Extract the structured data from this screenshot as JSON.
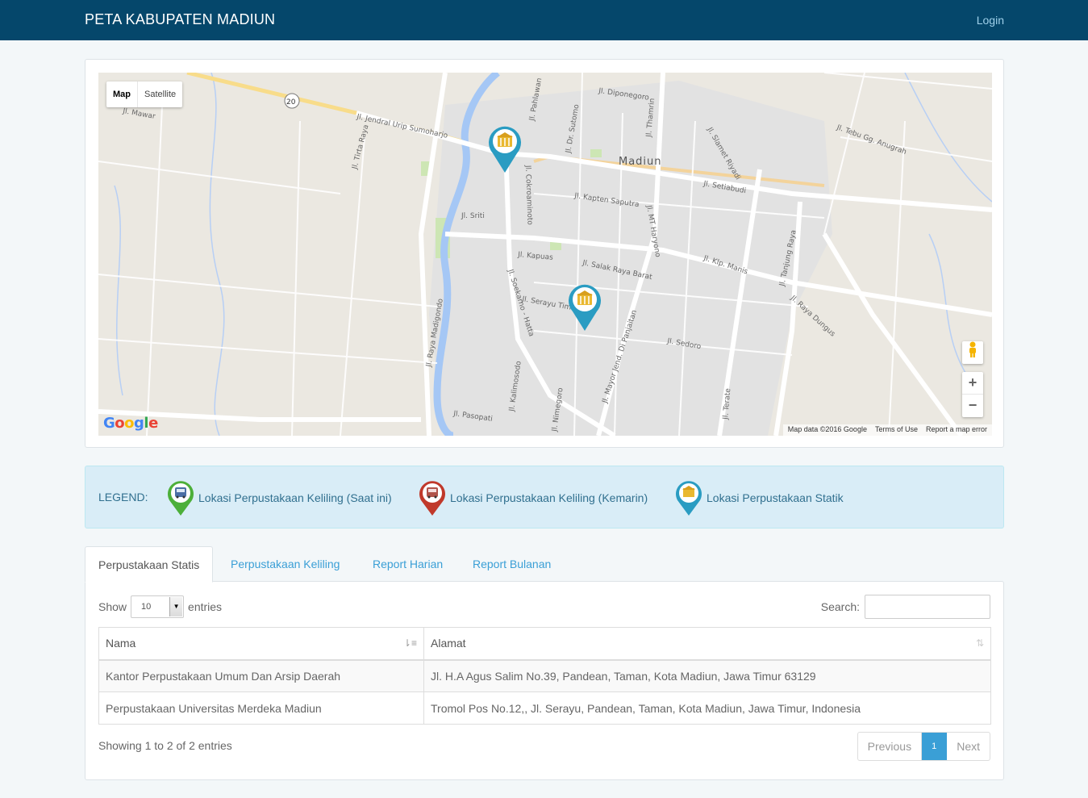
{
  "navbar": {
    "brand": "PETA KABUPATEN MADIUN",
    "login": "Login"
  },
  "map": {
    "type_buttons": [
      "Map",
      "Satellite"
    ],
    "city_label": "Madiun",
    "route_label": "20",
    "street_labels": [
      "Jl. Jendral Urip Sumoharjo",
      "Jl. Mawar",
      "Jl. Tirta Raya",
      "Jl. Diponegoro",
      "Jl. Pahlawan",
      "Jl. Dr. Sutomo",
      "Jl. Thamrin",
      "Jl. Slamet Riyadi",
      "Jl. Setiabudi",
      "Jl. Kapten Saputra",
      "Jl. Cokroaminoto",
      "Jl. Sriti",
      "Jl. Kapuas",
      "Jl. Salak Raya Barat",
      "Jl. MT Haryono",
      "Jl. Klp. Manis",
      "Jl. Tanjung Raya",
      "Jl. Raya Dungus",
      "Jl. Serayu Timur",
      "Jl. Soekarno - Hatta",
      "Jl. Raya Madigondo",
      "Jl. Sedoro",
      "Jl. Mayor Jend. Di Panjaitan",
      "Jl. Pasopati",
      "Jl. Nimegoro",
      "Jl. Tebu Gg. Anugrah",
      "Jl. Kalimosodo",
      "Jl. Terate"
    ],
    "attribution": [
      "Map data ©2016 Google",
      "Terms of Use",
      "Report a map error"
    ],
    "google_logo": [
      "G",
      "o",
      "o",
      "g",
      "l",
      "e"
    ],
    "zoom_in": "+",
    "zoom_out": "−",
    "markers": [
      {
        "type": "statik",
        "color": "#2a9cc2"
      },
      {
        "type": "statik",
        "color": "#2a9cc2"
      }
    ]
  },
  "legend": {
    "title": "LEGEND:",
    "items": [
      {
        "label": "Lokasi Perpustakaan Keliling (Saat ini)",
        "color": "#4caf3a",
        "icon": "bus-icon"
      },
      {
        "label": "Lokasi Perpustakaan Keliling (Kemarin)",
        "color": "#c0392b",
        "icon": "bus-icon"
      },
      {
        "label": "Lokasi Perpustakaan Statik",
        "color": "#2a9cc2",
        "icon": "library-icon"
      }
    ]
  },
  "tabs": [
    "Perpustakaan Statis",
    "Perpustakaan Keliling",
    "Report Harian",
    "Report Bulanan"
  ],
  "table": {
    "show_label": "Show",
    "entries_value": "10",
    "entries_label": "entries",
    "search_label": "Search:",
    "columns": [
      "Nama",
      "Alamat"
    ],
    "rows": [
      [
        "Kantor Perpustakaan Umum Dan Arsip Daerah",
        "Jl. H.A Agus Salim No.39, Pandean, Taman, Kota Madiun, Jawa Timur 63129"
      ],
      [
        "Perpustakaan Universitas Merdeka Madiun",
        "Tromol Pos No.12,, Jl. Serayu, Pandean, Taman, Kota Madiun, Jawa Timur, Indonesia"
      ]
    ],
    "info": "Showing 1 to 2 of 2 entries",
    "pagination": {
      "previous": "Previous",
      "current": "1",
      "next": "Next"
    }
  }
}
